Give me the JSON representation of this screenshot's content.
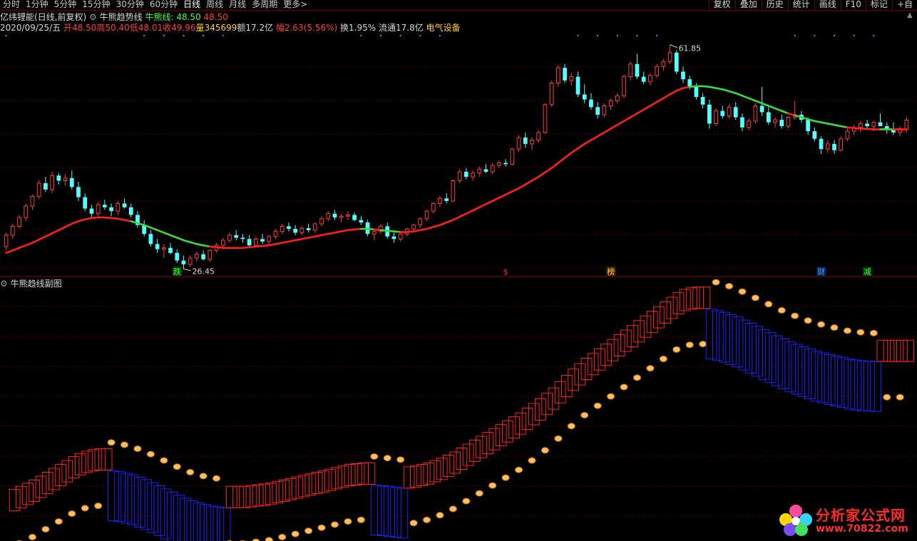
{
  "toolbar": {
    "periods": [
      "分时",
      "1分钟",
      "5分钟",
      "15分钟",
      "30分钟",
      "60分钟",
      "日线",
      "周线",
      "月线",
      "多周期",
      "更多>"
    ],
    "active_period": "日线",
    "tools": [
      "复权",
      "叠加",
      "历史",
      "统计",
      "画线",
      "F10",
      "标记",
      "+自"
    ]
  },
  "header": {
    "stock_name": "亿纬锂能",
    "mode": "(日线,前复权)",
    "indicator_name": "牛熊趋势线",
    "indicator_label": "牛熊线:",
    "indicator_green_value": "48.50",
    "indicator_red_value": "48.50",
    "date": "2020/09/25/五",
    "open_label": "开",
    "open": "48.50",
    "high_label": "高",
    "high": "50.40",
    "low_label": "低",
    "low": "48.01",
    "close_label": "收",
    "close": "49.96",
    "volume_label": "量",
    "volume": "345699",
    "amount_label": "额",
    "amount": "17.2亿",
    "change_label": "幅",
    "change": "2.63(5.56%)",
    "turnover_label": "换",
    "turnover": "1.95%",
    "float_label": "流通",
    "float": "17.8亿",
    "sector": "电气设备"
  },
  "sub_title": "牛熊趋线副图",
  "colors": {
    "up": "#ff3c3c",
    "down": "#54ffff",
    "bull_line": "#ff1e1e",
    "bear_line": "#3cdc3c",
    "bull_box": "#ff2020",
    "bear_box": "#2020ff",
    "coin": "#ffc060",
    "grid": "#5a0000"
  },
  "chart_data": {
    "type": "candlestick",
    "title": "",
    "high_marker": "61.85",
    "low_marker": "26.45",
    "event_markers": [
      "跌",
      "$",
      "榜",
      "财",
      "减"
    ],
    "candles": [
      [
        30.0,
        32.2,
        29.4,
        31.8
      ],
      [
        31.8,
        33.6,
        31.2,
        33.2
      ],
      [
        33.2,
        35.0,
        32.8,
        34.6
      ],
      [
        34.6,
        36.8,
        34.0,
        36.4
      ],
      [
        36.4,
        38.2,
        35.8,
        37.9
      ],
      [
        37.9,
        40.5,
        37.5,
        40.0
      ],
      [
        40.0,
        41.0,
        38.6,
        39.0
      ],
      [
        39.0,
        41.8,
        38.4,
        41.2
      ],
      [
        41.2,
        41.6,
        39.8,
        40.4
      ],
      [
        40.4,
        41.4,
        39.6,
        40.8
      ],
      [
        40.8,
        42.0,
        39.0,
        39.4
      ],
      [
        39.4,
        40.2,
        37.2,
        37.8
      ],
      [
        37.8,
        38.4,
        35.6,
        36.0
      ],
      [
        36.0,
        36.6,
        34.6,
        35.2
      ],
      [
        35.2,
        37.0,
        34.8,
        36.6
      ],
      [
        36.6,
        37.4,
        35.8,
        36.2
      ],
      [
        36.2,
        36.8,
        34.8,
        35.6
      ],
      [
        35.6,
        37.2,
        35.0,
        36.8
      ],
      [
        36.8,
        37.6,
        36.0,
        36.2
      ],
      [
        36.2,
        36.8,
        34.6,
        35.0
      ],
      [
        35.0,
        35.6,
        33.0,
        33.4
      ],
      [
        33.4,
        34.2,
        31.6,
        32.0
      ],
      [
        32.0,
        32.6,
        30.0,
        30.4
      ],
      [
        30.4,
        31.2,
        29.0,
        29.6
      ],
      [
        29.6,
        30.4,
        28.2,
        29.8
      ],
      [
        29.8,
        30.6,
        28.8,
        29.0
      ],
      [
        29.0,
        29.6,
        27.4,
        27.8
      ],
      [
        27.8,
        28.6,
        26.45,
        27.2
      ],
      [
        27.2,
        28.6,
        26.8,
        28.2
      ],
      [
        28.2,
        29.2,
        27.6,
        28.8
      ],
      [
        28.8,
        29.4,
        27.8,
        28.0
      ],
      [
        28.0,
        29.6,
        27.6,
        29.4
      ],
      [
        29.4,
        30.6,
        29.0,
        30.2
      ],
      [
        30.2,
        31.4,
        29.6,
        31.0
      ],
      [
        31.0,
        32.2,
        30.6,
        31.8
      ],
      [
        31.8,
        32.6,
        31.0,
        31.4
      ],
      [
        31.4,
        32.0,
        30.6,
        31.2
      ],
      [
        31.2,
        31.8,
        29.8,
        30.2
      ],
      [
        30.2,
        31.6,
        29.8,
        31.2
      ],
      [
        31.2,
        32.0,
        30.4,
        30.8
      ],
      [
        30.8,
        31.8,
        30.2,
        31.6
      ],
      [
        31.6,
        32.8,
        31.2,
        32.4
      ],
      [
        32.4,
        33.6,
        32.0,
        33.2
      ],
      [
        33.2,
        33.8,
        32.4,
        32.8
      ],
      [
        32.8,
        33.4,
        31.8,
        32.2
      ],
      [
        32.2,
        33.2,
        31.8,
        32.9
      ],
      [
        32.9,
        33.6,
        32.2,
        32.6
      ],
      [
        32.6,
        33.8,
        32.2,
        33.6
      ],
      [
        33.6,
        34.8,
        33.2,
        34.4
      ],
      [
        34.4,
        35.6,
        34.0,
        35.2
      ],
      [
        35.2,
        35.8,
        34.2,
        34.6
      ],
      [
        34.6,
        35.2,
        33.8,
        34.8
      ],
      [
        34.8,
        35.6,
        34.2,
        35.0
      ],
      [
        35.0,
        35.4,
        34.0,
        34.2
      ],
      [
        34.2,
        34.8,
        33.4,
        33.8
      ],
      [
        33.8,
        34.2,
        31.6,
        32.0
      ],
      [
        32.0,
        32.8,
        31.0,
        32.4
      ],
      [
        32.4,
        33.6,
        32.0,
        33.2
      ],
      [
        33.2,
        33.8,
        31.2,
        31.6
      ],
      [
        31.6,
        32.2,
        30.6,
        31.2
      ],
      [
        31.2,
        32.4,
        30.8,
        32.0
      ],
      [
        32.0,
        33.0,
        31.6,
        32.8
      ],
      [
        32.8,
        33.6,
        32.2,
        33.4
      ],
      [
        33.4,
        34.6,
        33.0,
        34.4
      ],
      [
        34.4,
        35.8,
        34.0,
        35.6
      ],
      [
        35.6,
        37.0,
        35.2,
        36.8
      ],
      [
        36.8,
        38.0,
        36.2,
        37.6
      ],
      [
        37.6,
        38.4,
        36.8,
        37.2
      ],
      [
        37.2,
        40.6,
        37.0,
        40.4
      ],
      [
        40.4,
        42.2,
        40.0,
        41.8
      ],
      [
        41.8,
        42.4,
        40.6,
        41.0
      ],
      [
        41.0,
        42.0,
        40.4,
        41.6
      ],
      [
        41.6,
        42.6,
        41.0,
        42.2
      ],
      [
        42.2,
        43.0,
        41.6,
        41.8
      ],
      [
        41.8,
        43.2,
        41.4,
        42.8
      ],
      [
        42.8,
        43.6,
        42.4,
        43.2
      ],
      [
        43.2,
        43.8,
        42.6,
        43.0
      ],
      [
        43.0,
        45.6,
        42.8,
        45.4
      ],
      [
        45.4,
        47.6,
        45.0,
        47.2
      ],
      [
        47.2,
        48.0,
        45.6,
        46.2
      ],
      [
        46.2,
        47.2,
        45.2,
        46.8
      ],
      [
        46.8,
        48.4,
        46.4,
        48.0
      ],
      [
        48.0,
        52.6,
        47.8,
        52.4
      ],
      [
        52.4,
        56.2,
        52.0,
        55.8
      ],
      [
        55.8,
        58.6,
        55.2,
        58.2
      ],
      [
        58.2,
        58.8,
        55.8,
        56.2
      ],
      [
        56.2,
        57.4,
        55.4,
        56.8
      ],
      [
        56.8,
        57.6,
        53.6,
        54.0
      ],
      [
        54.0,
        55.6,
        52.6,
        53.2
      ],
      [
        53.2,
        54.2,
        51.6,
        52.0
      ],
      [
        52.0,
        52.8,
        50.2,
        50.8
      ],
      [
        50.8,
        52.6,
        50.4,
        52.2
      ],
      [
        52.2,
        53.4,
        51.6,
        53.0
      ],
      [
        53.0,
        54.2,
        52.6,
        53.8
      ],
      [
        53.8,
        57.2,
        53.4,
        56.8
      ],
      [
        56.8,
        59.2,
        56.2,
        58.8
      ],
      [
        58.8,
        60.4,
        56.4,
        56.8
      ],
      [
        56.8,
        57.6,
        55.6,
        56.0
      ],
      [
        56.0,
        57.4,
        55.4,
        57.0
      ],
      [
        57.0,
        58.8,
        56.6,
        58.4
      ],
      [
        58.4,
        59.6,
        57.8,
        59.2
      ],
      [
        59.2,
        61.85,
        58.8,
        60.6
      ],
      [
        60.6,
        61.0,
        57.2,
        57.6
      ],
      [
        57.6,
        58.4,
        55.8,
        56.4
      ],
      [
        56.4,
        57.0,
        54.8,
        55.2
      ],
      [
        55.2,
        55.8,
        53.2,
        53.6
      ],
      [
        53.6,
        54.2,
        51.8,
        52.4
      ],
      [
        52.4,
        53.2,
        48.6,
        49.4
      ],
      [
        49.4,
        51.8,
        49.0,
        51.4
      ],
      [
        51.4,
        52.2,
        50.2,
        50.6
      ],
      [
        50.6,
        52.4,
        50.2,
        52.0
      ],
      [
        52.0,
        52.8,
        50.0,
        50.4
      ],
      [
        50.4,
        51.0,
        48.2,
        48.8
      ],
      [
        48.8,
        50.2,
        48.4,
        49.8
      ],
      [
        49.8,
        52.6,
        49.4,
        52.2
      ],
      [
        52.2,
        55.2,
        50.6,
        51.2
      ],
      [
        51.2,
        52.0,
        49.2,
        49.6
      ],
      [
        49.6,
        50.4,
        48.8,
        50.0
      ],
      [
        50.0,
        50.8,
        48.6,
        49.0
      ],
      [
        49.0,
        50.6,
        48.6,
        50.4
      ],
      [
        50.4,
        53.0,
        50.0,
        50.8
      ],
      [
        50.8,
        51.4,
        49.6,
        50.0
      ],
      [
        50.0,
        50.4,
        47.6,
        48.2
      ],
      [
        48.2,
        48.8,
        46.6,
        47.0
      ],
      [
        47.0,
        47.4,
        44.6,
        45.4
      ],
      [
        45.4,
        46.8,
        44.8,
        46.2
      ],
      [
        46.2,
        46.8,
        44.6,
        45.2
      ],
      [
        45.2,
        47.4,
        45.0,
        47.0
      ],
      [
        47.0,
        48.6,
        46.6,
        48.2
      ],
      [
        48.2,
        49.2,
        47.6,
        48.8
      ],
      [
        48.8,
        49.8,
        48.0,
        49.4
      ],
      [
        49.4,
        50.0,
        48.4,
        49.0
      ],
      [
        49.0,
        49.8,
        48.2,
        49.6
      ],
      [
        49.6,
        51.0,
        49.2,
        49.0
      ],
      [
        49.0,
        49.6,
        47.8,
        48.4
      ],
      [
        48.4,
        49.6,
        47.6,
        48.0
      ],
      [
        48.0,
        49.0,
        47.4,
        48.6
      ],
      [
        48.5,
        50.4,
        48.01,
        49.96
      ]
    ],
    "bull_bear_line": [
      29.0,
      29.4,
      29.8,
      30.2,
      30.6,
      31.1,
      31.6,
      32.1,
      32.6,
      33.1,
      33.6,
      34.0,
      34.3,
      34.5,
      34.6,
      34.6,
      34.5,
      34.4,
      34.2,
      34.0,
      33.7,
      33.4,
      33.0,
      32.6,
      32.2,
      31.8,
      31.4,
      31.0,
      30.7,
      30.4,
      30.2,
      30.0,
      29.9,
      29.8,
      29.8,
      29.8,
      29.8,
      29.9,
      30.0,
      30.1,
      30.2,
      30.4,
      30.6,
      30.8,
      31.0,
      31.2,
      31.4,
      31.6,
      31.8,
      32.0,
      32.2,
      32.4,
      32.6,
      32.7,
      32.8,
      32.8,
      32.7,
      32.6,
      32.5,
      32.4,
      32.3,
      32.3,
      32.4,
      32.6,
      32.8,
      33.1,
      33.4,
      33.8,
      34.2,
      34.7,
      35.2,
      35.7,
      36.2,
      36.7,
      37.2,
      37.7,
      38.2,
      38.7,
      39.2,
      39.8,
      40.4,
      41.0,
      41.7,
      42.4,
      43.2,
      44.0,
      44.8,
      45.5,
      46.2,
      46.8,
      47.4,
      48.0,
      48.6,
      49.2,
      49.8,
      50.4,
      51.0,
      51.6,
      52.2,
      52.8,
      53.4,
      54.0,
      54.6,
      55.0,
      55.2,
      55.3,
      55.3,
      55.2,
      55.0,
      54.8,
      54.5,
      54.2,
      53.8,
      53.4,
      53.0,
      52.6,
      52.2,
      51.8,
      51.4,
      51.0,
      50.7,
      50.4,
      50.1,
      49.8,
      49.6,
      49.4,
      49.2,
      49.0,
      48.8,
      48.7,
      48.6,
      48.55,
      48.5,
      48.5,
      48.5,
      48.5,
      48.5,
      48.5,
      48.5,
      48.5
    ],
    "ylim": [
      25.5,
      63.5
    ]
  }
}
